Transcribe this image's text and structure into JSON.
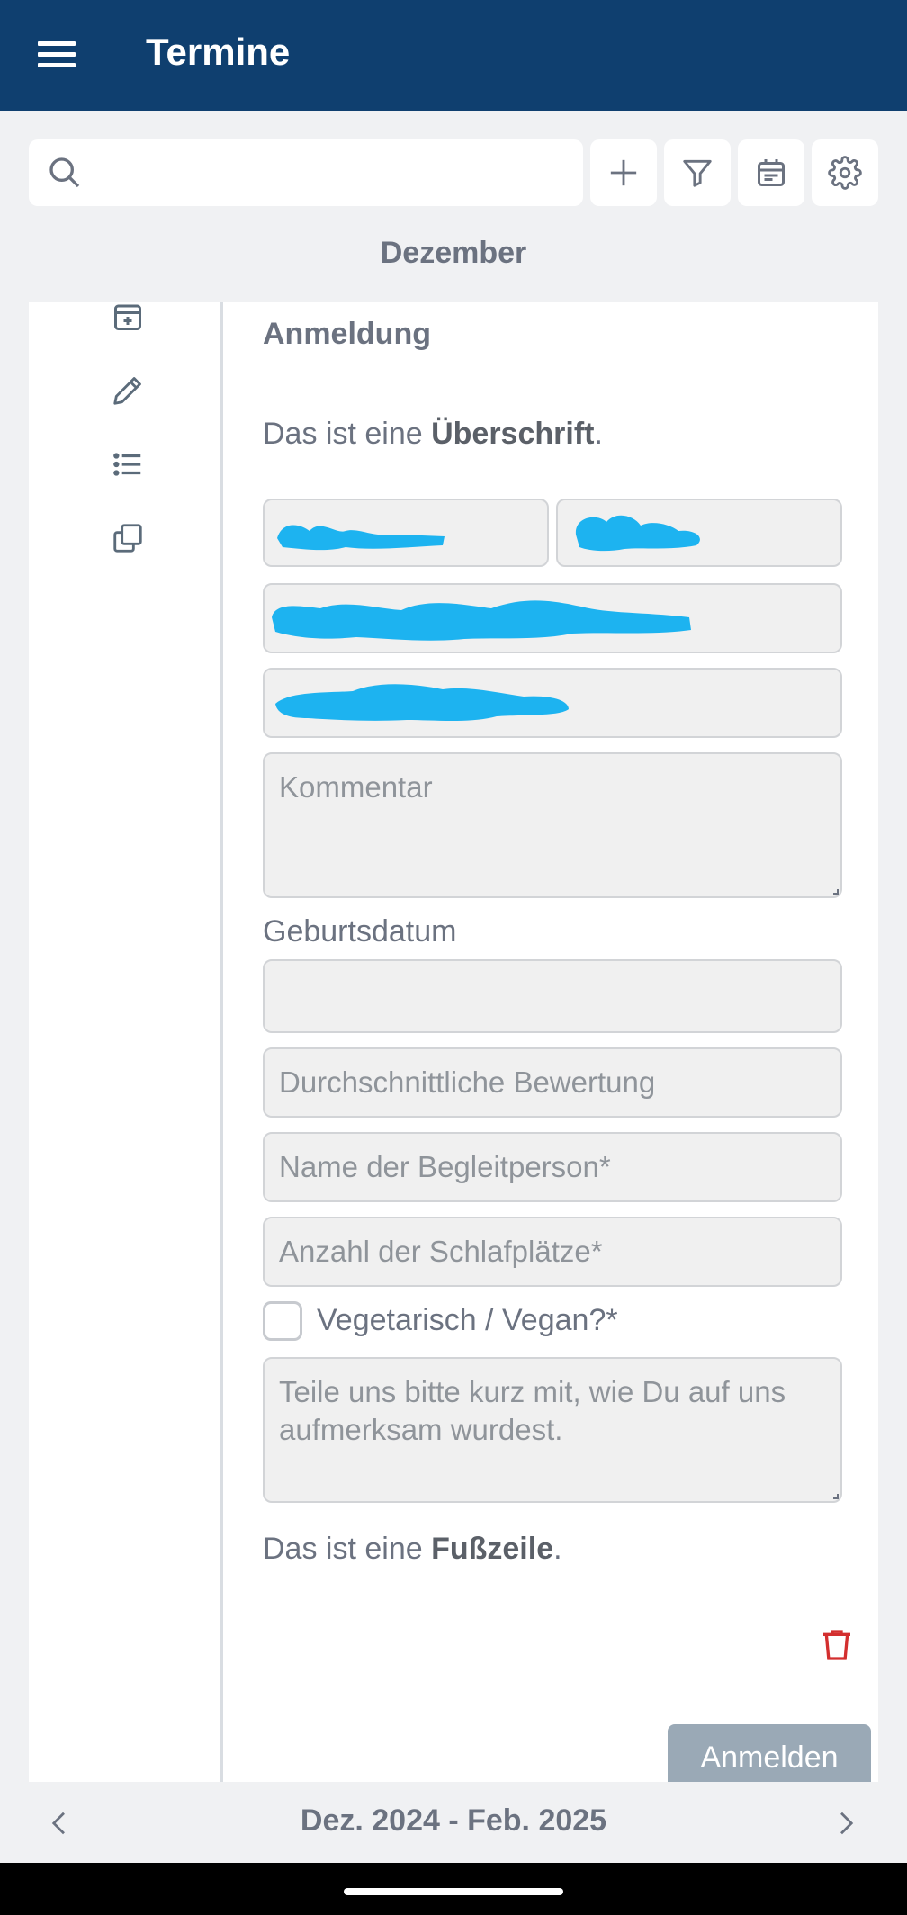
{
  "app": {
    "title": "Termine"
  },
  "toolbar": {
    "search_placeholder": "",
    "icons": [
      "search-icon",
      "plus-icon",
      "filter-icon",
      "calendar-icon",
      "gear-icon"
    ]
  },
  "month_header": "Dezember",
  "side_actions": [
    "calendar-add-icon",
    "pencil-icon",
    "list-icon",
    "copy-icon"
  ],
  "form": {
    "title": "Anmeldung",
    "header_text_prefix": "Das ist eine ",
    "header_text_bold": "Überschrift",
    "header_text_suffix": ".",
    "comment_placeholder": "Kommentar",
    "birthdate_label": "Geburtsdatum",
    "rating_placeholder": "Durchschnittliche Bewertung",
    "companion_placeholder": "Name der Begleitperson*",
    "beds_placeholder": "Anzahl der Schlafplätze*",
    "vegetarian_label": "Vegetarisch / Vegan?*",
    "source_placeholder": "Teile uns bitte kurz mit, wie Du auf uns aufmerksam wurdest.",
    "footer_text_prefix": "Das ist eine ",
    "footer_text_bold": "Fußzeile",
    "footer_text_suffix": ".",
    "submit_label": "Anmelden"
  },
  "date_range": "Dez. 2024 - Feb. 2025",
  "colors": {
    "appbar": "#0f3f6f",
    "redaction": "#1db3f0",
    "delete": "#d32f2f",
    "submit": "#9aa9b6"
  }
}
